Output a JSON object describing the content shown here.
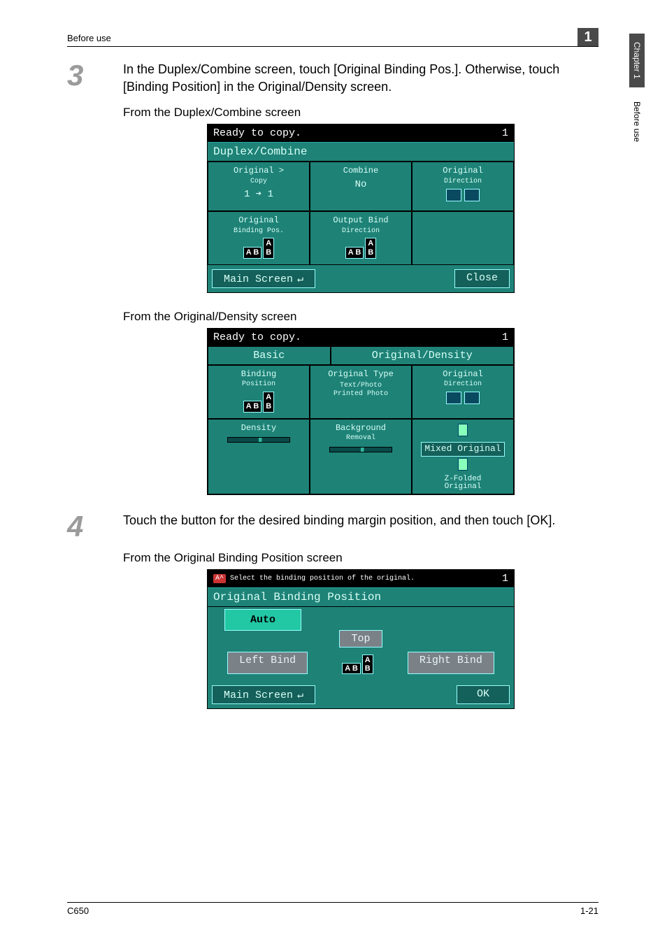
{
  "header": {
    "left": "Before use",
    "right_num": "1"
  },
  "sidetabs": {
    "chapter": "Chapter 1",
    "before": "Before use"
  },
  "step3": {
    "num": "3",
    "text": "In the Duplex/Combine screen, touch [Original Binding Pos.]. Otherwise, touch [Binding Position] in the Original/Density screen.",
    "sub1": "From the Duplex/Combine screen",
    "sub2": "From the Original/Density screen"
  },
  "panel1": {
    "status": "Ready to copy.",
    "count": "1",
    "title": "Duplex/Combine",
    "c1_l1": "Original >",
    "c1_l1b": "Copy",
    "c1_l2": "1 ➔ 1",
    "c2_l1": "Combine",
    "c2_l2": "No",
    "c3_l1": "Original",
    "c3_l1b": "Direction",
    "c4_l1": "Original",
    "c4_l1b": "Binding Pos.",
    "c5_l1": "Output Bind",
    "c5_l1b": "Direction",
    "btn_main": "Main Screen",
    "btn_close": "Close"
  },
  "panel2": {
    "status": "Ready to copy.",
    "count": "1",
    "tab1": "Basic",
    "tab2": "Original/Density",
    "c1_l1": "Binding",
    "c1_l1b": "Position",
    "c2_l1": "Original Type",
    "c2_l2": "Text/Photo",
    "c2_l3": "Printed Photo",
    "c3_l1": "Original",
    "c3_l1b": "Direction",
    "c4_l1": "Density",
    "c5_l1": "Background",
    "c5_l1b": "Removal",
    "c6_l1": "Mixed Original",
    "c7_l1": "Z-Folded",
    "c7_l1b": "Original"
  },
  "step4": {
    "num": "4",
    "text": "Touch the button for the desired binding margin position, and then touch [OK].",
    "sub1": "From the Original Binding Position screen"
  },
  "panel3": {
    "hint": "Select the binding position of the original.",
    "count": "1",
    "title": "Original Binding Position",
    "auto": "Auto",
    "top": "Top",
    "left": "Left Bind",
    "right": "Right Bind",
    "btn_main": "Main Screen",
    "btn_ok": "OK"
  },
  "footer": {
    "left": "C650",
    "right": "1-21"
  }
}
